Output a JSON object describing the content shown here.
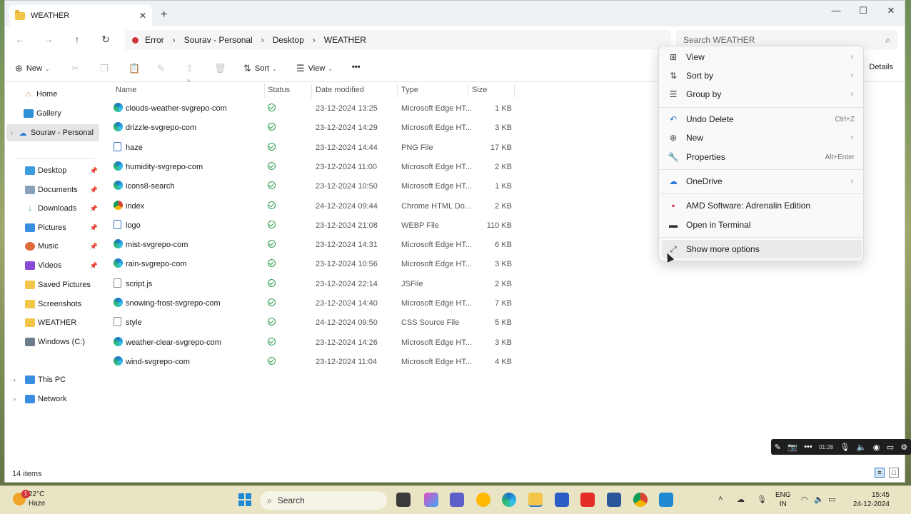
{
  "window": {
    "tab_title": "WEATHER",
    "close_tab": "✕",
    "new_tab": "+",
    "minimize": "—",
    "maximize": "☐",
    "close": "✕"
  },
  "address": {
    "back": "←",
    "forward": "→",
    "up": "↑",
    "refresh": "↻",
    "crumbs": [
      "Error",
      "Sourav - Personal",
      "Desktop",
      "WEATHER"
    ],
    "sep": "›",
    "search_placeholder": "Search WEATHER",
    "search_icon": "⌕"
  },
  "toolbar": {
    "new_label": "New",
    "sort_label": "Sort",
    "view_label": "View",
    "more": "•••",
    "details_label": "Details",
    "icons": [
      "cut-icon",
      "copy-icon",
      "paste-icon",
      "rename-icon",
      "share-icon",
      "delete-icon"
    ]
  },
  "sidebar": {
    "items": [
      {
        "label": "Home",
        "color": "#d87a2f"
      },
      {
        "label": "Gallery",
        "color": "#2f8fd8"
      },
      {
        "label": "Sourav - Personal",
        "color": "#2f7ad8"
      },
      {
        "label": "Desktop",
        "color": "#3a9be0"
      },
      {
        "label": "Documents",
        "color": "#8aa0b8"
      },
      {
        "label": "Downloads",
        "color": "#2f9a5a"
      },
      {
        "label": "Pictures",
        "color": "#3a8ee0"
      },
      {
        "label": "Music",
        "color": "#e06a3a"
      },
      {
        "label": "Videos",
        "color": "#8a4ad8"
      },
      {
        "label": "Saved Pictures",
        "color": "#f3c548"
      },
      {
        "label": "Screenshots",
        "color": "#f3c548"
      },
      {
        "label": "WEATHER",
        "color": "#f3c548"
      },
      {
        "label": "Windows (C:)",
        "color": "#6c7c8c"
      },
      {
        "label": "This PC",
        "color": "#3a8ee0"
      },
      {
        "label": "Network",
        "color": "#3a8ee0"
      }
    ]
  },
  "columns": {
    "name": "Name",
    "status": "Status",
    "date": "Date modified",
    "type": "Type",
    "size": "Size"
  },
  "files": [
    {
      "name": "clouds-weather-svgrepo-com",
      "date": "23-12-2024 13:25",
      "type": "Microsoft Edge HT...",
      "size": "1 KB",
      "icon": "edge"
    },
    {
      "name": "drizzle-svgrepo-com",
      "date": "23-12-2024 14:29",
      "type": "Microsoft Edge HT...",
      "size": "3 KB",
      "icon": "edge"
    },
    {
      "name": "haze",
      "date": "23-12-2024 14:44",
      "type": "PNG File",
      "size": "17 KB",
      "icon": "image"
    },
    {
      "name": "humidity-svgrepo-com",
      "date": "23-12-2024 11:00",
      "type": "Microsoft Edge HT...",
      "size": "2 KB",
      "icon": "edge"
    },
    {
      "name": "icons8-search",
      "date": "23-12-2024 10:50",
      "type": "Microsoft Edge HT...",
      "size": "1 KB",
      "icon": "edge"
    },
    {
      "name": "index",
      "date": "24-12-2024 09:44",
      "type": "Chrome HTML Do...",
      "size": "2 KB",
      "icon": "chrome"
    },
    {
      "name": "logo",
      "date": "23-12-2024 21:08",
      "type": "WEBP File",
      "size": "110 KB",
      "icon": "image"
    },
    {
      "name": "mist-svgrepo-com",
      "date": "23-12-2024 14:31",
      "type": "Microsoft Edge HT...",
      "size": "6 KB",
      "icon": "edge"
    },
    {
      "name": "rain-svgrepo-com",
      "date": "23-12-2024 10:56",
      "type": "Microsoft Edge HT...",
      "size": "3 KB",
      "icon": "edge"
    },
    {
      "name": "script.js",
      "date": "23-12-2024 22:14",
      "type": "JSFile",
      "size": "2 KB",
      "icon": "doc"
    },
    {
      "name": "snowing-frost-svgrepo-com",
      "date": "23-12-2024 14:40",
      "type": "Microsoft Edge HT...",
      "size": "7 KB",
      "icon": "edge"
    },
    {
      "name": "style",
      "date": "24-12-2024 09:50",
      "type": "CSS Source File",
      "size": "5 KB",
      "icon": "doc"
    },
    {
      "name": "weather-clear-svgrepo-com",
      "date": "23-12-2024 14:26",
      "type": "Microsoft Edge HT...",
      "size": "3 KB",
      "icon": "edge"
    },
    {
      "name": "wind-svgrepo-com",
      "date": "23-12-2024 11:04",
      "type": "Microsoft Edge HT...",
      "size": "4 KB",
      "icon": "edge"
    }
  ],
  "status_bar": {
    "item_count": "14 items"
  },
  "context_menu": {
    "items": [
      {
        "label": "View",
        "icon": "⊞",
        "shortcut": "",
        "arrow": "›"
      },
      {
        "label": "Sort by",
        "icon": "⇅",
        "shortcut": "",
        "arrow": "›"
      },
      {
        "label": "Group by",
        "icon": "☰",
        "shortcut": "",
        "arrow": "›"
      },
      {
        "label": "Undo Delete",
        "icon": "↶",
        "shortcut": "Ctrl+Z",
        "arrow": ""
      },
      {
        "label": "New",
        "icon": "⊕",
        "shortcut": "",
        "arrow": "›"
      },
      {
        "label": "Properties",
        "icon": "🔧",
        "shortcut": "Alt+Enter",
        "arrow": ""
      },
      {
        "label": "OneDrive",
        "icon": "☁",
        "shortcut": "",
        "arrow": "›"
      },
      {
        "label": "AMD Software: Adrenalin Edition",
        "icon": "▪",
        "shortcut": "",
        "arrow": ""
      },
      {
        "label": "Open in Terminal",
        "icon": "▬",
        "shortcut": "",
        "arrow": ""
      },
      {
        "label": "Show more options",
        "icon": "⤢",
        "shortcut": "",
        "arrow": ""
      }
    ]
  },
  "recorder": {
    "time": "01:28"
  },
  "taskbar": {
    "temp": "22°C",
    "condition": "Haze",
    "badge": "1",
    "search_label": "Search",
    "lang_1": "ENG",
    "lang_2": "IN",
    "time": "15:45",
    "date": "24-12-2024"
  }
}
